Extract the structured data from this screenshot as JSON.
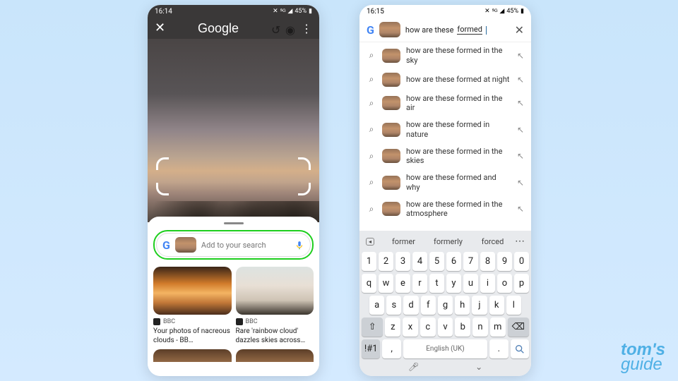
{
  "status": {
    "time_left": "16:14",
    "time_right": "16:15",
    "battery": "45%",
    "icons": "✕ ⁵ᴳ ◢◣"
  },
  "left": {
    "google_label": "Google",
    "search_placeholder": "Add to your search",
    "results": [
      {
        "source": "BBC",
        "title": "Your photos of nacreous clouds - BB…"
      },
      {
        "source": "BBC",
        "title": "Rare 'rainbow cloud' dazzles skies across…"
      }
    ]
  },
  "right": {
    "query_prefix": "how are these ",
    "query_underlined": "formed",
    "suggestions": [
      "how are these formed in the sky",
      "how are these formed at night",
      "how are these formed in the air",
      "how are these formed in nature",
      "how are these formed in the skies",
      "how are these formed and why",
      "how are these formed in the atmosphere"
    ],
    "kbd_suggestions": [
      "former",
      "formerly",
      "forced"
    ],
    "space_label": "English (UK)",
    "rows": {
      "nums": [
        "1",
        "2",
        "3",
        "4",
        "5",
        "6",
        "7",
        "8",
        "9",
        "0"
      ],
      "r1": [
        "q",
        "w",
        "e",
        "r",
        "t",
        "y",
        "u",
        "i",
        "o",
        "p"
      ],
      "r2": [
        "a",
        "s",
        "d",
        "f",
        "g",
        "h",
        "j",
        "k",
        "l"
      ],
      "r3": [
        "z",
        "x",
        "c",
        "v",
        "b",
        "n",
        "m"
      ],
      "sym": "!#1",
      "comma": ",",
      "period": "."
    }
  },
  "watermark": {
    "line1": "tom's",
    "line2": "guide"
  }
}
